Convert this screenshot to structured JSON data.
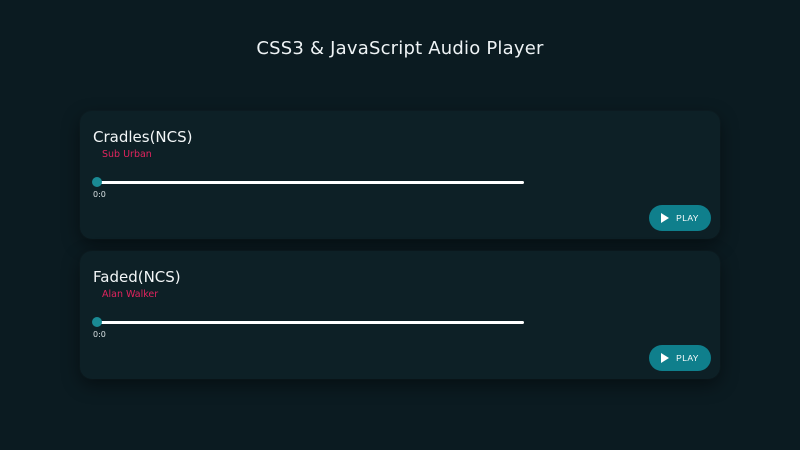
{
  "page": {
    "title": "CSS3 & JavaScript Audio Player"
  },
  "players": [
    {
      "title": "Cradles(NCS)",
      "artist": "Sub Urban",
      "time": "0:0",
      "progress": 0,
      "button_label": "PLAY",
      "button_icon": "play-icon"
    },
    {
      "title": "Faded(NCS)",
      "artist": "Alan Walker",
      "time": "0:0",
      "progress": 0,
      "button_label": "PLAY",
      "button_icon": "play-icon"
    }
  ],
  "colors": {
    "background": "#0b1b21",
    "card": "#0d2026",
    "accent": "#0f7f8c",
    "artist": "#e0245e",
    "thumb": "#1a8a94"
  }
}
